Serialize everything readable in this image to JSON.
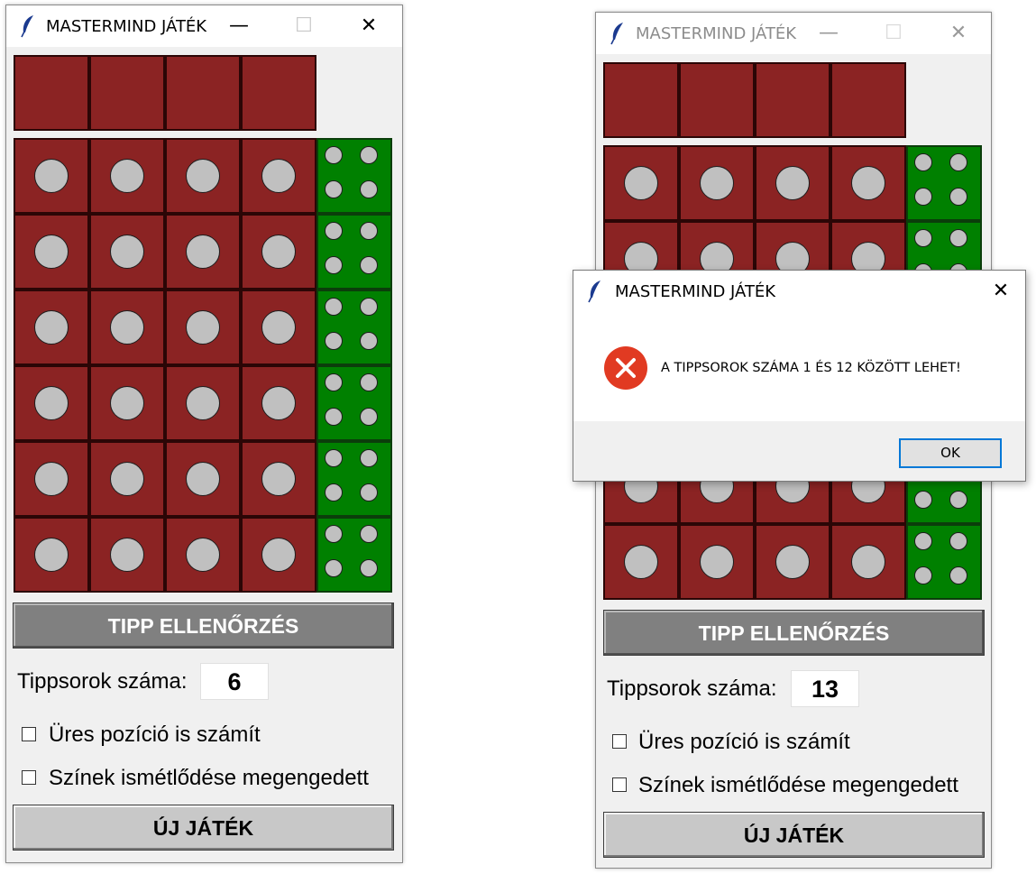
{
  "windows": [
    {
      "title": "MASTERMIND JÁTÉK",
      "titlebar_buttons": {
        "minimize": "—",
        "maximize": "☐",
        "close": "✕"
      },
      "guess_rows": 6,
      "check_button_label": "TIPP ELLENŐRZÉS",
      "rows_label": "Tippsorok száma:",
      "rows_value": "6",
      "checkbox_empty_label": "Üres pozíció is számít",
      "checkbox_repeat_label": "Színek ismétlődése megengedett",
      "new_game_label": "ÚJ JÁTÉK"
    },
    {
      "title": "MASTERMIND JÁTÉK",
      "titlebar_buttons": {
        "minimize": "—",
        "maximize": "☐",
        "close": "✕"
      },
      "check_button_label": "TIPP ELLENŐRZÉS",
      "rows_label": "Tippsorok száma:",
      "rows_value": "13",
      "checkbox_empty_label": "Üres pozíció is számít",
      "checkbox_repeat_label": "Színek ismétlődése megengedett",
      "new_game_label": "ÚJ JÁTÉK"
    }
  ],
  "dialog": {
    "title": "MASTERMIND JÁTÉK",
    "close": "✕",
    "message": "A TIPPSOROK SZÁMA 1 ÉS 12 KÖZÖTT LEHET!",
    "ok_label": "OK",
    "icon": "error-icon"
  },
  "colors": {
    "cell": "#8b2323",
    "peg": "#c0c0c0",
    "feedback": "#008000",
    "check_button": "#808080",
    "new_button": "#c8c8c8",
    "error": "#e13a22"
  }
}
